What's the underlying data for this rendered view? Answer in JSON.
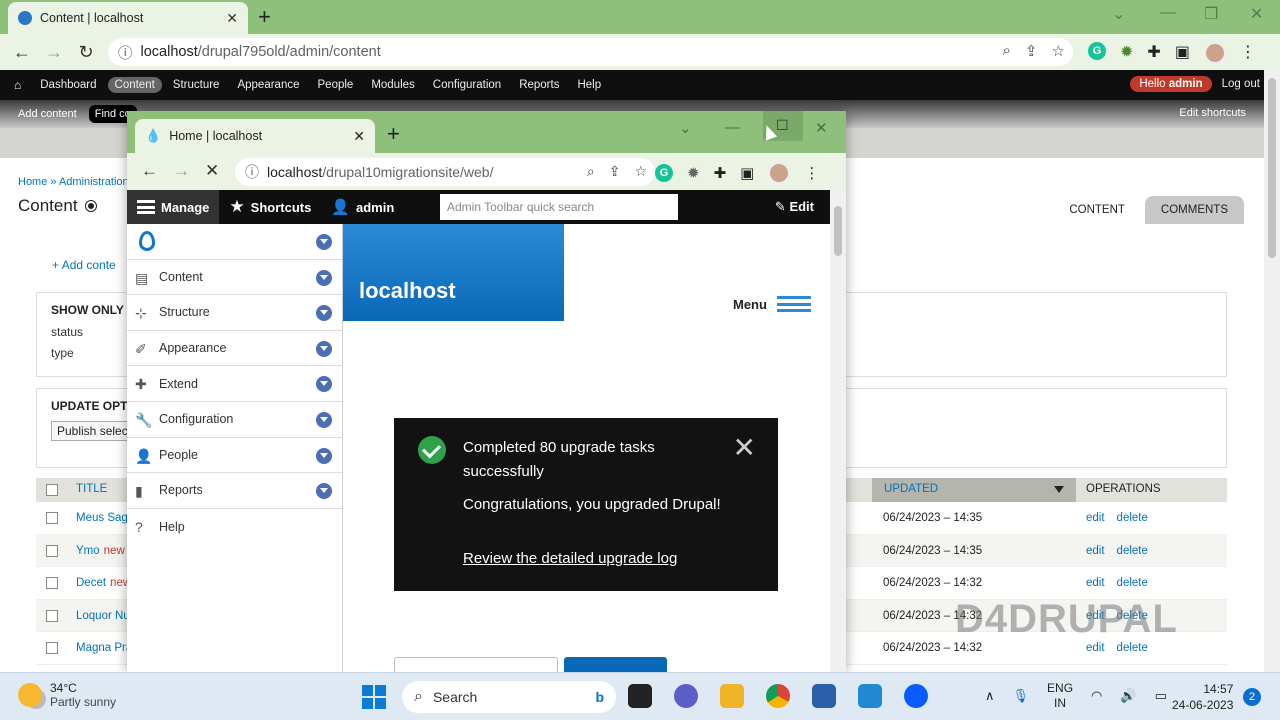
{
  "back_browser": {
    "tab_title": "Content | localhost",
    "url_host": "localhost",
    "url_path": "/drupal795old/admin/content"
  },
  "d7_admin": {
    "menu": [
      "Dashboard",
      "Content",
      "Structure",
      "Appearance",
      "People",
      "Modules",
      "Configuration",
      "Reports",
      "Help"
    ],
    "hello_prefix": "Hello",
    "hello_user": "admin",
    "logout": "Log out",
    "shortcuts": [
      "Add content",
      "Find co"
    ],
    "edit_shortcuts": "Edit shortcuts"
  },
  "d7_page": {
    "breadcrumb": "Home » Administration",
    "title": "Content",
    "tabs": [
      "CONTENT",
      "COMMENTS"
    ],
    "add_content": "Add conte",
    "show_only_legend": "SHOW ONLY I",
    "filter_rows": [
      "status",
      "type"
    ],
    "update_legend": "UPDATE OPTI",
    "update_select": "Publish selec",
    "table": {
      "col_title": "TITLE",
      "col_updated": "UPDATED",
      "col_operations": "OPERATIONS",
      "rows": [
        {
          "title": "Meus Sag",
          "new": "",
          "updated": "06/24/2023 – 14:35"
        },
        {
          "title": "Ymo",
          "new": "new",
          "updated": "06/24/2023 – 14:35"
        },
        {
          "title": "Decet",
          "new": "new",
          "updated": "06/24/2023 – 14:32"
        },
        {
          "title": "Loquor Nu",
          "new": "",
          "updated": "06/24/2023 – 14:32"
        },
        {
          "title": "Magna Pra",
          "new": "",
          "updated": "06/24/2023 – 14:32"
        }
      ],
      "op_edit": "edit",
      "op_delete": "delete"
    }
  },
  "watermark": "D4DRUPAL",
  "front_browser": {
    "tab_title": "Home | localhost",
    "url_host": "localhost",
    "url_path": "/drupal10migrationsite/web/"
  },
  "d10_toolbar": {
    "manage": "Manage",
    "shortcuts": "Shortcuts",
    "user": "admin",
    "search_placeholder": "Admin Toolbar quick search",
    "edit": "Edit"
  },
  "tray_items": [
    {
      "label": "Content",
      "icon": "content-icon"
    },
    {
      "label": "Structure",
      "icon": "structure-icon"
    },
    {
      "label": "Appearance",
      "icon": "appearance-icon"
    },
    {
      "label": "Extend",
      "icon": "extend-icon"
    },
    {
      "label": "Configuration",
      "icon": "wrench-icon"
    },
    {
      "label": "People",
      "icon": "people-icon"
    },
    {
      "label": "Reports",
      "icon": "reports-icon"
    },
    {
      "label": "Help",
      "icon": "help-icon"
    }
  ],
  "site": {
    "name": "localhost",
    "menu": "Menu"
  },
  "notice": {
    "line1": "Completed 80 upgrade tasks successfully",
    "line2": "Congratulations, you upgraded Drupal!",
    "link": "Review the detailed upgrade log"
  },
  "taskbar": {
    "temp": "34°C",
    "weather": "Partly sunny",
    "search": "Search",
    "lang_top": "ENG",
    "lang_bottom": "IN",
    "time": "14:57",
    "date": "24-06-2023",
    "notifications": "2"
  },
  "colors": {
    "chrome_green": "#8ec07c",
    "drupal_blue": "#0a69b6",
    "link_blue": "#0074bd",
    "success_green": "#2fa14a"
  }
}
